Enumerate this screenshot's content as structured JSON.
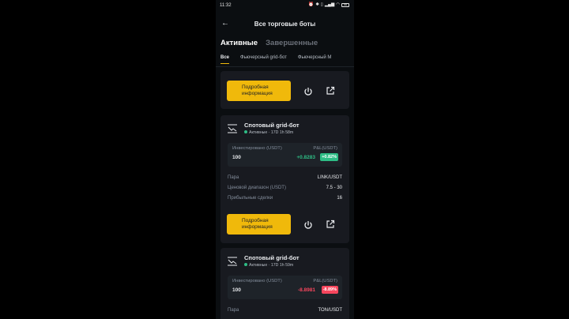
{
  "status_bar": {
    "time": "11:32",
    "icons": [
      "alarm-icon",
      "bluetooth-icon",
      "vibrate-icon",
      "signal-icon",
      "wifi-icon"
    ],
    "battery": "58"
  },
  "header": {
    "title": "Все торговые боты"
  },
  "tabs": [
    {
      "label": "Активные",
      "active": true
    },
    {
      "label": "Завершенные",
      "active": false
    }
  ],
  "filters": [
    {
      "label": "Все",
      "active": true
    },
    {
      "label": "Фьючерсный grid-бот",
      "active": false
    },
    {
      "label": "Фьючерсный М",
      "active": false
    }
  ],
  "cards": [
    {
      "details_label": "Подробная информация"
    },
    {
      "name": "Спотовый grid-бот",
      "status": "Активные · 17D 1h 58m",
      "invested_label": "Инвестировано (USDT)",
      "pnl_label": "P&L(USDT)",
      "invested": "100",
      "pnl": "+0.8283",
      "pnl_pct": "+0.82%",
      "rows": [
        {
          "k": "Пара",
          "v": "LINK/USDT"
        },
        {
          "k": "Ценовой диапазон (USDT)",
          "v": "7.5 - 30"
        },
        {
          "k": "Прибыльные сделки",
          "v": "16"
        }
      ],
      "details_label": "Подробная информация"
    },
    {
      "name": "Спотовый grid-бот",
      "status": "Активные · 17D 1h 59m",
      "invested_label": "Инвестировано (USDT)",
      "pnl_label": "P&L(USDT)",
      "invested": "100",
      "pnl": "-8.8981",
      "pnl_pct": "-8.89%",
      "rows": [
        {
          "k": "Пара",
          "v": "TON/USDT"
        }
      ]
    }
  ],
  "colors": {
    "accent": "#f0b90b",
    "positive": "#2ebd85",
    "negative": "#f6465d",
    "background": "#0b0e11",
    "card": "#181a20"
  }
}
